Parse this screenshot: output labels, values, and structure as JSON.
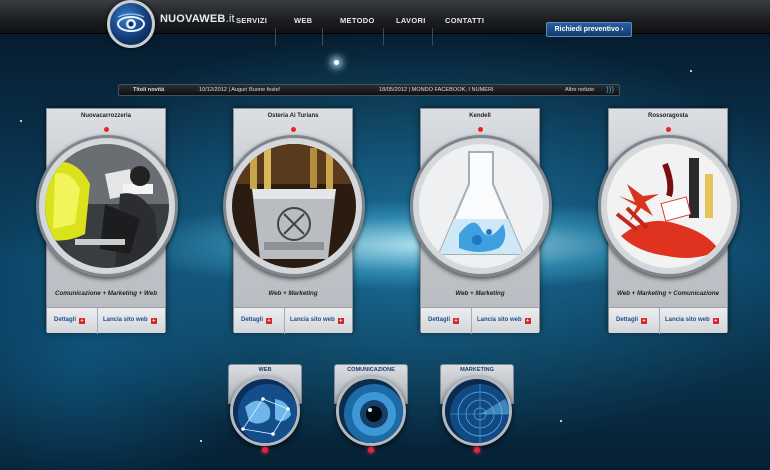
{
  "header": {
    "logo_name": "NUOVAWEB",
    "logo_tld": ".it",
    "nav": [
      "SERVIZI",
      "WEB",
      "METODO",
      "LAVORI",
      "CONTATTI"
    ],
    "cta_label": "Richiedi preventivo ›"
  },
  "ticker": {
    "label": "Titoli novità",
    "item1": "10/12/2012 | Auguri Buone feste!",
    "item2": "18/05/2012 | MONDO FACEBOOK, I NUMERI",
    "more": "Altre notizie"
  },
  "cards": [
    {
      "title": "Nuovacarrozzeria",
      "services": "Comunicazione + Marketing + Web",
      "details": "Dettagli",
      "launch": "Lancia sito web"
    },
    {
      "title": "Osteria Ai Turians",
      "services": "Web + Marketing",
      "details": "Dettagli",
      "launch": "Lancia sito web"
    },
    {
      "title": "Kendell",
      "services": "Web + Marketing",
      "details": "Dettagli",
      "launch": "Lancia sito web"
    },
    {
      "title": "Rossoragosta",
      "services": "Web + Marketing + Comunicazione",
      "details": "Dettagli",
      "launch": "Lancia sito web"
    }
  ],
  "services": [
    "WEB",
    "COMUNICAZIONE",
    "MARKETING"
  ],
  "colors": {
    "accent_red": "#d52a2a",
    "link_blue": "#1d4f8f",
    "cta_blue": "#2a5e9c"
  }
}
